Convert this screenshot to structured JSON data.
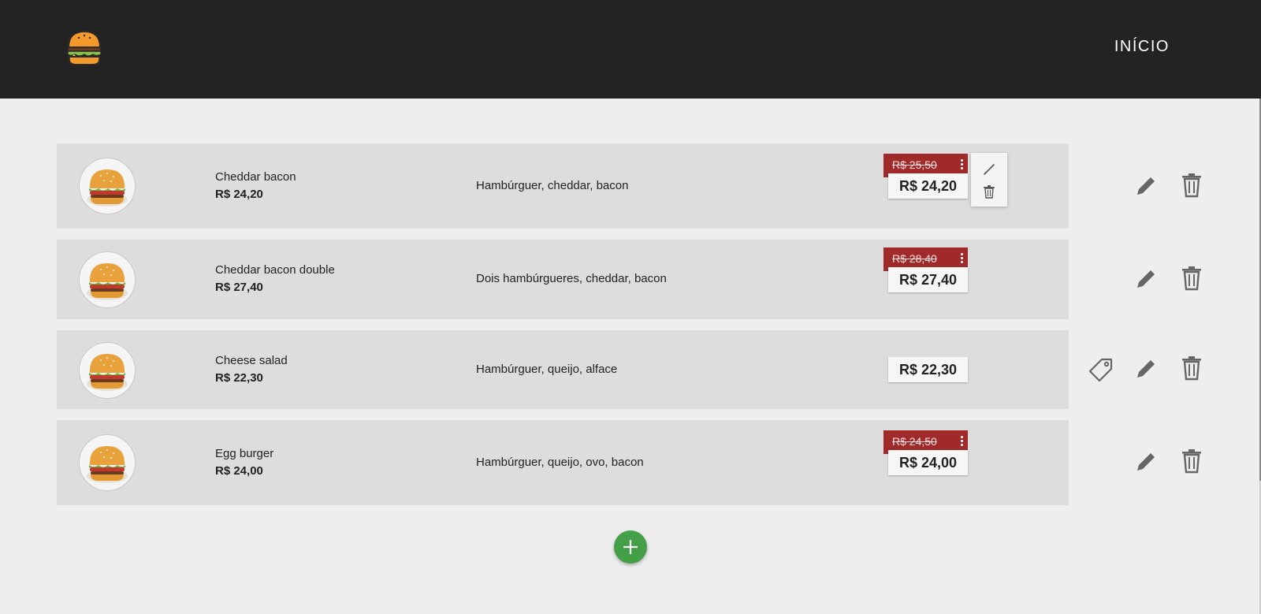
{
  "header": {
    "logo_icon": "burger-icon",
    "nav_home": "INÍCIO"
  },
  "products": [
    {
      "name": "Cheddar bacon",
      "price": "R$ 24,20",
      "description": "Hambúrguer, cheddar, bacon",
      "old_price": "R$ 25,50",
      "display_price": "R$ 24,20",
      "has_discount": true
    },
    {
      "name": "Cheddar bacon double",
      "price": "R$ 27,40",
      "description": "Dois hambúrgueres, cheddar, bacon",
      "old_price": "R$ 28,40",
      "display_price": "R$ 27,40",
      "has_discount": true
    },
    {
      "name": "Cheese salad",
      "price": "R$ 22,30",
      "description": "Hambúrguer, queijo, alface",
      "old_price": "",
      "display_price": "R$ 22,30",
      "has_discount": false
    },
    {
      "name": "Egg burger",
      "price": "R$ 24,00",
      "description": "Hambúrguer, queijo, ovo, bacon",
      "old_price": "R$ 24,50",
      "display_price": "R$ 24,00",
      "has_discount": true
    }
  ],
  "icons": {
    "edit": "pencil-icon",
    "delete": "trash-icon",
    "discount": "tag-icon",
    "more": "more-vertical-icon",
    "add": "plus-icon"
  },
  "colors": {
    "header_bg": "#232323",
    "discount_tag": "#a02a2a",
    "add_button": "#43a047",
    "row_bg": "#dddddd",
    "page_bg": "#eeeeee"
  }
}
